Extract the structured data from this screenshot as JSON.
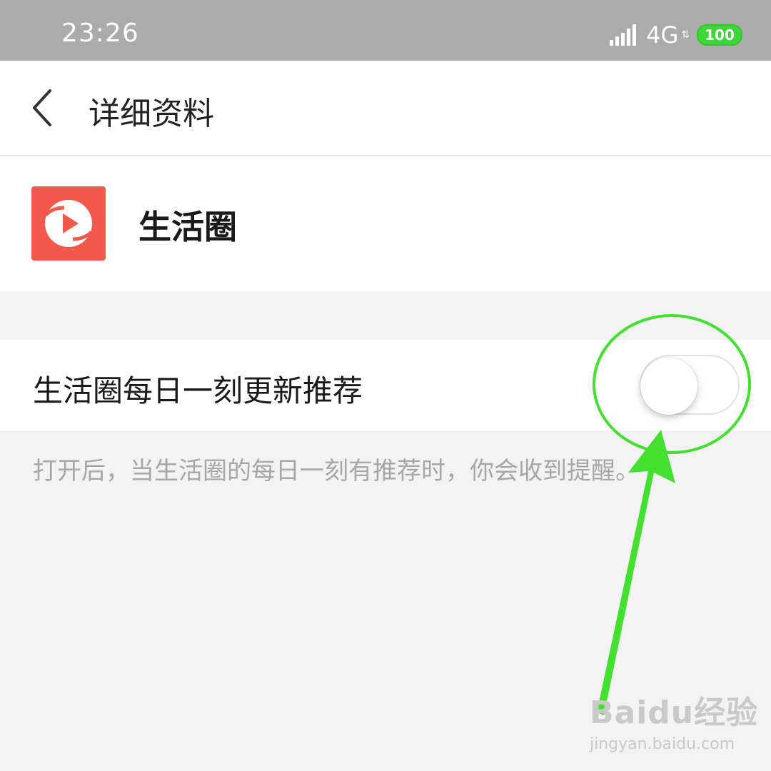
{
  "status_bar": {
    "time": "23:26",
    "network": "4G",
    "battery": "100",
    "battery_color": "#3ed63a"
  },
  "nav": {
    "title": "详细资料",
    "back_icon": "chevron-left-icon"
  },
  "profile": {
    "app_name": "生活圈",
    "icon_color": "#f2594b"
  },
  "setting": {
    "label": "生活圈每日一刻更新推荐",
    "toggle_state": "off",
    "hint": "打开后，当生活圈的每日一刻有推荐时，你会收到提醒。"
  },
  "annotation": {
    "color": "#44e02f",
    "shapes": [
      "circle",
      "arrow"
    ]
  },
  "watermark": {
    "logo": "Baidu经验",
    "site": "jingyan.baidu.com"
  }
}
